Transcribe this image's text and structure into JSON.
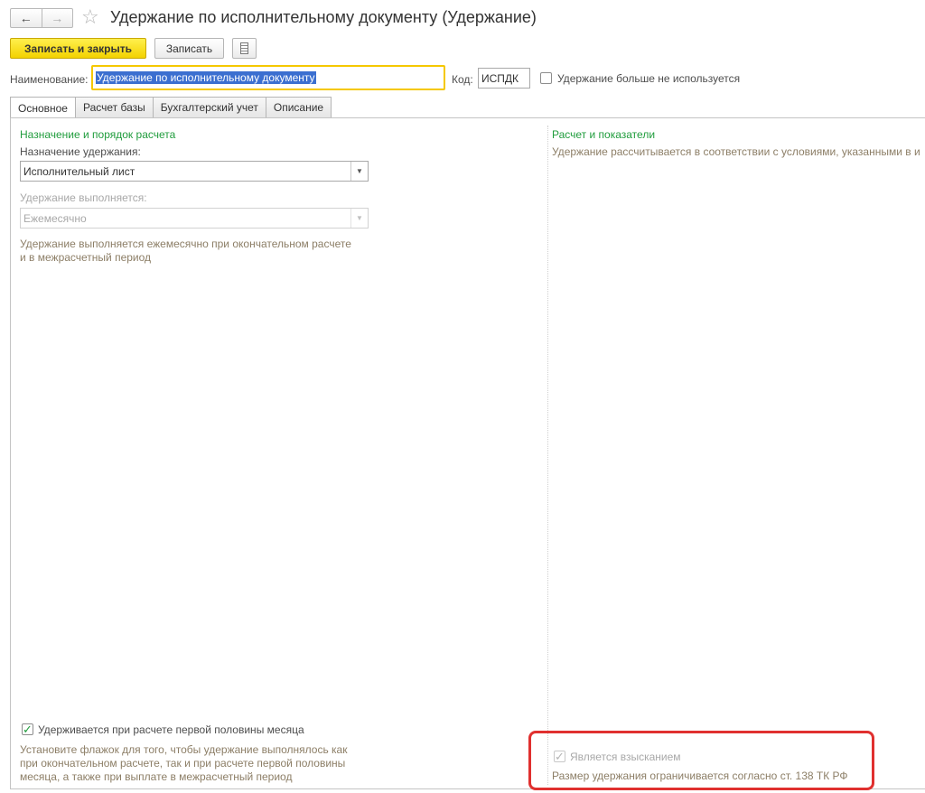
{
  "window": {
    "title": "Удержание по исполнительному документу (Удержание)",
    "back_icon": "←",
    "forward_icon": "→",
    "favorite_icon": "☆"
  },
  "toolbar": {
    "save_close_label": "Записать и закрыть",
    "save_label": "Записать"
  },
  "header": {
    "name_label": "Наименование:",
    "name_value": "Удержание по исполнительному документу",
    "code_label": "Код:",
    "code_value": "ИСПДК",
    "unused_label": "Удержание больше не используется",
    "unused_checked": false
  },
  "tabs": [
    {
      "label": "Основное",
      "active": true
    },
    {
      "label": "Расчет базы",
      "active": false
    },
    {
      "label": "Бухгалтерский учет",
      "active": false
    },
    {
      "label": "Описание",
      "active": false
    }
  ],
  "left": {
    "section_title": "Назначение и порядок расчета",
    "purpose_label": "Назначение удержания:",
    "purpose_value": "Исполнительный лист",
    "performed_label": "Удержание выполняется:",
    "performed_value": "Ежемесячно",
    "performed_note_1": "Удержание выполняется ежемесячно при окончательном расчете",
    "performed_note_2": "и в межрасчетный период",
    "first_half_label": "Удерживается при расчете первой половины месяца",
    "first_half_checked": true,
    "first_half_note_1": "Установите флажок для того, чтобы удержание выполнялось как",
    "first_half_note_2": "при окончательном расчете, так и при расчете первой половины",
    "first_half_note_3": "месяца, а также при выплате в межрасчетный период"
  },
  "right": {
    "section_title": "Расчет и показатели",
    "calc_note": "Удержание рассчитывается в соответствии с условиями, указанными в и",
    "collection_label": "Является взысканием",
    "collection_checked": true,
    "collection_note": "Размер удержания ограничивается согласно ст. 138 ТК РФ"
  },
  "colors": {
    "accent_yellow": "#f3d200",
    "section_green": "#1f9c3c",
    "note_brown": "#8c7e66",
    "highlight_red": "#e0302f"
  }
}
